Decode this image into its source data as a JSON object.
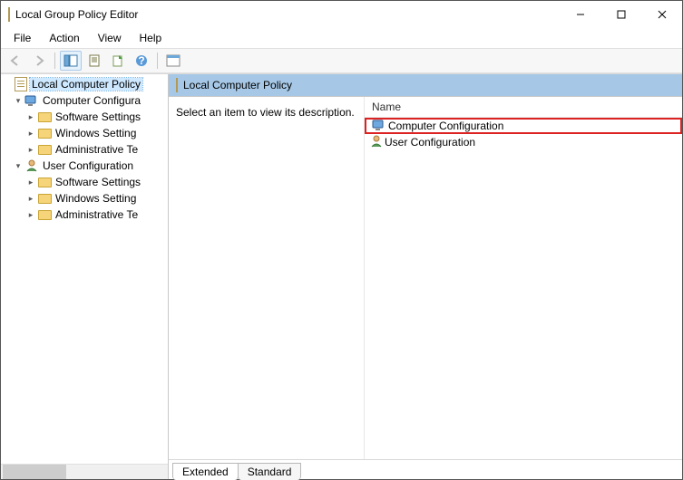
{
  "window": {
    "title": "Local Group Policy Editor"
  },
  "menu": {
    "file": "File",
    "action": "Action",
    "view": "View",
    "help": "Help"
  },
  "tree": {
    "root": "Local Computer Policy",
    "comp": "Computer Configura",
    "user": "User Configuration",
    "sw": "Software Settings",
    "win": "Windows Setting",
    "adm": "Administrative Te"
  },
  "header": {
    "title": "Local Computer Policy"
  },
  "desc": {
    "text": "Select an item to view its description."
  },
  "list": {
    "col_name": "Name",
    "items": {
      "comp": "Computer Configuration",
      "user": "User Configuration"
    }
  },
  "tabs": {
    "extended": "Extended",
    "standard": "Standard"
  }
}
